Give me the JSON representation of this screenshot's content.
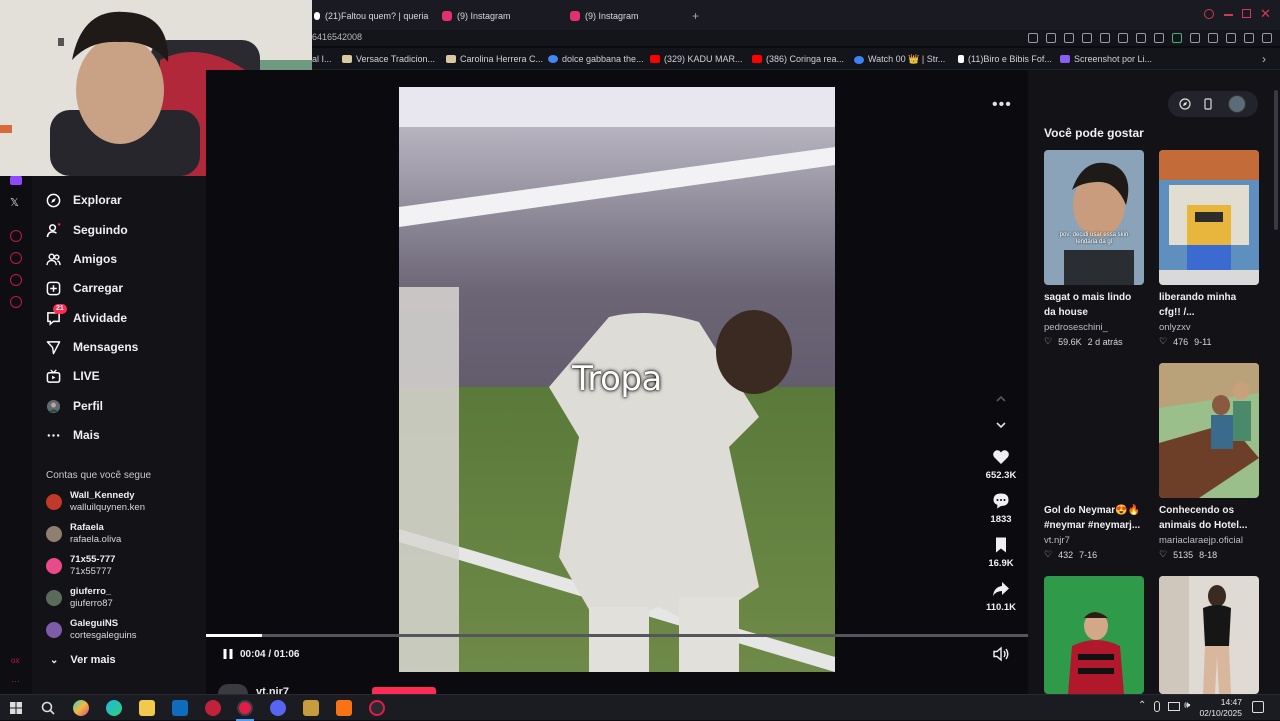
{
  "browser": {
    "tabs": [
      {
        "label": "(21)Faltou quem? | queria",
        "icon_color": "#ffffff"
      },
      {
        "label": "(9) Instagram",
        "icon_color": "#e1306c"
      },
      {
        "label": "(9) Instagram",
        "icon_color": "#e1306c"
      }
    ],
    "add_tab_symbol": "+",
    "url_fragment": "6416542008",
    "bookmarks": [
      {
        "label": "al I...",
        "icon_color": "#888888"
      },
      {
        "label": "Versace Tradicion...",
        "icon_color": "#d8c9a0"
      },
      {
        "label": "Carolina Herrera C...",
        "icon_color": "#d8c9a0"
      },
      {
        "label": "dolce gabbana the...",
        "icon_color": "#4285f4"
      },
      {
        "label": "(329) KADU MAR...",
        "icon_color": "#ff0000"
      },
      {
        "label": "(386) Coringa rea...",
        "icon_color": "#ff0000"
      },
      {
        "label": "Watch 00 👑 | Str...",
        "icon_color": "#3b82f6"
      },
      {
        "label": "(11)Biro e Bibis Fof...",
        "icon_color": "#ffffff"
      },
      {
        "label": "Screenshot por Li...",
        "icon_color": "#8b5cf6"
      }
    ]
  },
  "sidebar": {
    "items": [
      {
        "label": "Explorar",
        "icon": "compass-icon"
      },
      {
        "label": "Seguindo",
        "icon": "following-icon"
      },
      {
        "label": "Amigos",
        "icon": "friends-icon"
      },
      {
        "label": "Carregar",
        "icon": "upload-icon"
      },
      {
        "label": "Atividade",
        "icon": "activity-icon",
        "badge": "21"
      },
      {
        "label": "Mensagens",
        "icon": "messages-icon"
      },
      {
        "label": "LIVE",
        "icon": "live-icon"
      },
      {
        "label": "Perfil",
        "icon": "profile-icon"
      },
      {
        "label": "Mais",
        "icon": "more-icon"
      }
    ],
    "following_title": "Contas que você segue",
    "accounts": [
      {
        "name": "Wall_Kennedy",
        "handle": "walluilquynen.ken",
        "color": "#c0392b"
      },
      {
        "name": "Rafaela",
        "handle": "rafaela.oliva",
        "color": "#8e7f6f"
      },
      {
        "name": "71x55-777",
        "handle": "71x55777",
        "color": "#e94b8a"
      },
      {
        "name": "giuferro_",
        "handle": "giuferro87",
        "color": "#5a6b5a"
      },
      {
        "name": "GaleguiNS",
        "handle": "cortesgaleguins",
        "color": "#7d5ba6"
      }
    ],
    "see_more": "Ver mais"
  },
  "video": {
    "caption": "Tropa",
    "time": "00:04 / 01:06",
    "progress": 0.068,
    "likes": "652.3K",
    "comments": "1833",
    "saves": "16.9K",
    "shares": "110.1K",
    "author_peek": "vt.njr7"
  },
  "right_panel": {
    "title": "Você pode gostar",
    "cards": [
      {
        "title": "sagat o mais lindo da house",
        "user": "pedroseschini_",
        "likes": "59.6K",
        "date": "2 d atrás"
      },
      {
        "title": "liberando minha cfg!! /...",
        "user": "onlyzxv",
        "likes": "476",
        "date": "9-11"
      },
      {
        "title": "Gol do Neymar😍🔥 #neymar #neymarj...",
        "user": "vt.njr7",
        "likes": "432",
        "date": "7-16"
      },
      {
        "title": "Conhecendo os animais do Hotel...",
        "user": "mariaclaraejp.oficial",
        "likes": "5135",
        "date": "8-18"
      }
    ],
    "thumb_overlay_text": "pov: decidi usar essa skin lendária da gl"
  },
  "taskbar": {
    "time": "14:47",
    "date": "02/10/2025"
  }
}
